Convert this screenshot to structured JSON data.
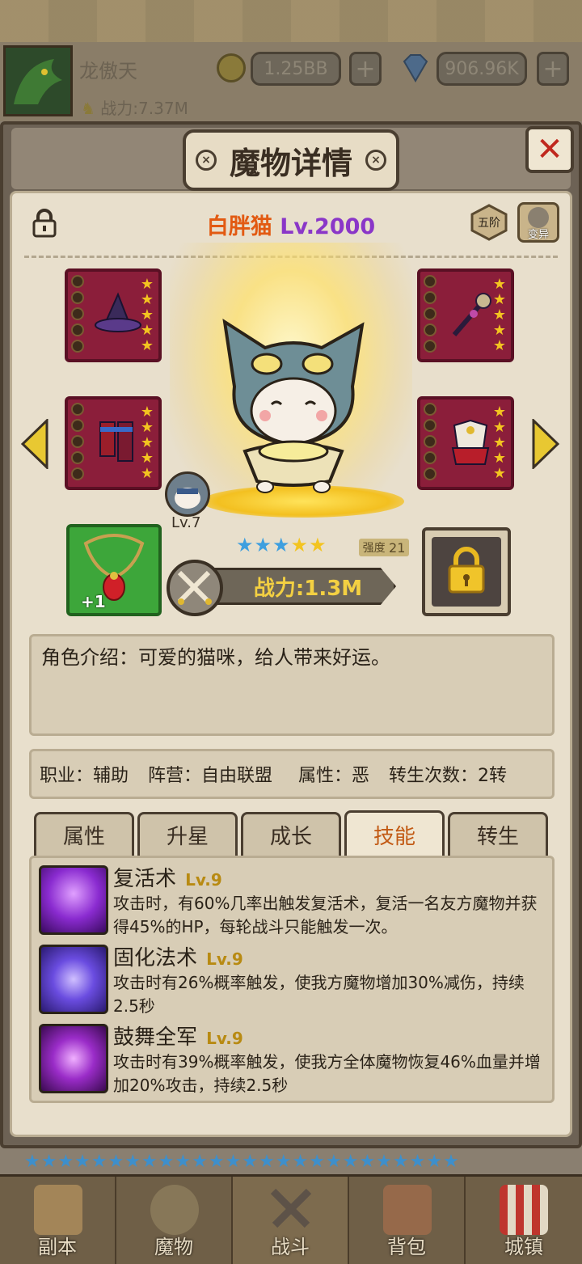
{
  "player": {
    "name": "龙傲天",
    "power": "战力:7.37M",
    "gold": "1.25BB",
    "gems": "906.96K"
  },
  "modal": {
    "title": "魔物详情",
    "close_icon": "close-icon"
  },
  "monster": {
    "name": "白胖猫",
    "level": "Lv.2000",
    "tier_badge": "五阶",
    "mutate_label": "变异",
    "mini_level": "Lv.7",
    "stars": 5,
    "filled_stars": 3,
    "strength_label": "强度",
    "strength_value": "21",
    "amulet_plus": "+1",
    "power": "战力:1.3M",
    "intro": "角色介绍：可爱的猫咪，给人带来好运。",
    "info": {
      "job": "职业：辅助",
      "camp": "阵营：自由联盟",
      "attr": "属性：恶",
      "rebirth": "转生次数：2转"
    }
  },
  "tabs": [
    {
      "label": "属性",
      "active": false
    },
    {
      "label": "升星",
      "active": false
    },
    {
      "label": "成长",
      "active": false
    },
    {
      "label": "技能",
      "active": true
    },
    {
      "label": "转生",
      "active": false
    }
  ],
  "skills": [
    {
      "name": "复活术",
      "level": "Lv.9",
      "desc": "攻击时，有60%几率出触发复活术，复活一名友方魔物并获得45%的HP，每轮战斗只能触发一次。",
      "color": "#8a2bd0"
    },
    {
      "name": "固化法术",
      "level": "Lv.9",
      "desc": "攻击时有26%概率触发，使我方魔物增加30%减伤，持续2.5秒",
      "color": "#6a4ce0"
    },
    {
      "name": "鼓舞全军",
      "level": "Lv.9",
      "desc": "攻击时有39%概率触发，使我方全体魔物恢复46%血量并增加20%攻击，持续2.5秒",
      "color": "#9a2cc8"
    }
  ],
  "nav": [
    {
      "label": "副本",
      "icon": "map-scroll-icon"
    },
    {
      "label": "魔物",
      "icon": "monster-helmet-icon"
    },
    {
      "label": "战斗",
      "icon": "crossed-swords-icon",
      "active": true
    },
    {
      "label": "背包",
      "icon": "backpack-icon"
    },
    {
      "label": "城镇",
      "icon": "town-shop-icon"
    }
  ]
}
